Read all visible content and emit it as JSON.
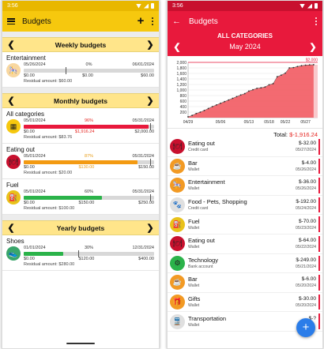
{
  "left": {
    "status_time": "3:56",
    "appbar": {
      "title": "Budgets",
      "add_label": "+"
    },
    "sections": {
      "weekly": {
        "title": "Weekly budgets",
        "items": [
          {
            "name": "Entertainment",
            "start": "05/26/2024",
            "pct": "0%",
            "end": "06/01/2024",
            "spent": "$0.00",
            "mid": "$0.00",
            "budget": "$60.00",
            "residual": "Residual amount: $60.00",
            "fill": 0.0,
            "tick": 0.32,
            "icon": "carousel-icon",
            "color": "#d0d0d0",
            "pct_class": "",
            "mid_class": ""
          }
        ]
      },
      "monthly": {
        "title": "Monthly budgets",
        "items": [
          {
            "name": "All categories",
            "start": "05/01/2024",
            "pct": "96%",
            "end": "05/31/2024",
            "spent": "$0.00",
            "mid": "$1,916.24",
            "budget": "$2,000.00",
            "residual": "Residual amount: $83.76",
            "fill": 0.96,
            "tick": 0.97,
            "icon": "categories-icon",
            "color": "#e8193c",
            "pct_class": "red",
            "mid_class": "red"
          },
          {
            "name": "Eating out",
            "start": "05/01/2024",
            "pct": "87%",
            "end": "05/31/2024",
            "spent": "$0.00",
            "mid": "$130.00",
            "budget": "$150.00",
            "residual": "Residual amount: $20.00",
            "fill": 0.87,
            "tick": 0.97,
            "icon": "dining-icon",
            "color": "#f39a12",
            "pct_class": "orange",
            "mid_class": "orange"
          },
          {
            "name": "Fuel",
            "start": "05/01/2024",
            "pct": "60%",
            "end": "05/31/2024",
            "spent": "$0.00",
            "mid": "$150.00",
            "budget": "$250.00",
            "residual": "Residual amount: $100.00",
            "fill": 0.6,
            "tick": 0.97,
            "icon": "fuel-pump-icon",
            "color": "#2bb34a",
            "pct_class": "",
            "mid_class": ""
          }
        ]
      },
      "yearly": {
        "title": "Yearly budgets",
        "items": [
          {
            "name": "Shoes",
            "start": "01/01/2024",
            "pct": "30%",
            "end": "12/31/2024",
            "spent": "$0.00",
            "mid": "$120.00",
            "budget": "$400.00",
            "residual": "Residual amount: $280.00",
            "fill": 0.3,
            "tick": 0.42,
            "icon": "shoe-icon",
            "color": "#2bb34a",
            "pct_class": "",
            "mid_class": ""
          }
        ]
      }
    }
  },
  "right": {
    "status_time": "3:56",
    "appbar": {
      "title": "Budgets"
    },
    "category_title": "ALL CATEGORIES",
    "month": "May 2024",
    "total_label": "Total:",
    "total_value": "$-1,916.24",
    "transactions": [
      {
        "name": "Eating out",
        "account": "Credit card",
        "amount": "$-32.00",
        "date": "05/27/2024",
        "icon": "dining-icon",
        "icon_bg": "#c8102e"
      },
      {
        "name": "Bar",
        "account": "Wallet",
        "amount": "$-4.00",
        "date": "05/26/2024",
        "icon": "coffee-icon",
        "icon_bg": "#f29a24"
      },
      {
        "name": "Entertainment",
        "account": "Wallet",
        "amount": "$-36.00",
        "date": "05/26/2024",
        "icon": "carousel-icon",
        "icon_bg": "#f29a24"
      },
      {
        "name": "Food - Pets, Shopping",
        "account": "Credit card",
        "amount": "$-192.00",
        "date": "05/24/2024",
        "icon": "pet-food-icon",
        "icon_bg": "#e0e0e0"
      },
      {
        "name": "Fuel",
        "account": "Wallet",
        "amount": "$-70.00",
        "date": "05/23/2024",
        "icon": "fuel-pump-icon",
        "icon_bg": "#e9c21a"
      },
      {
        "name": "Eating out",
        "account": "Wallet",
        "amount": "$-64.00",
        "date": "05/22/2024",
        "icon": "dining-icon",
        "icon_bg": "#c8102e"
      },
      {
        "name": "Technology",
        "account": "Bank account",
        "amount": "$-249.00",
        "date": "05/21/2024",
        "icon": "technology-icon",
        "icon_bg": "#2bb34a"
      },
      {
        "name": "Bar",
        "account": "Wallet",
        "amount": "$-6.00",
        "date": "05/20/2024",
        "icon": "coffee-icon",
        "icon_bg": "#f29a24"
      },
      {
        "name": "Gifts",
        "account": "Wallet",
        "amount": "$-30.00",
        "date": "05/20/2024",
        "icon": "gift-icon",
        "icon_bg": "#f29a24"
      },
      {
        "name": "Transportation",
        "account": "Wallet",
        "amount": "$-?",
        "date": "",
        "icon": "train-icon",
        "icon_bg": "#e0e0e0"
      }
    ]
  },
  "chart_data": {
    "type": "area",
    "title": "",
    "xlabel": "",
    "ylabel": "",
    "ylim": [
      0,
      2000
    ],
    "y_ticks": [
      "200",
      "400",
      "600",
      "800",
      "1,000",
      "1,200",
      "1,400",
      "1,600",
      "1,800",
      "2,000"
    ],
    "x_ticks": [
      "04/29",
      "05/06",
      "05/13",
      "05/18",
      "05/22",
      "05/27"
    ],
    "budget_line": 2000,
    "budget_label": "$2,000",
    "series": [
      {
        "values": [
          {
            "x": "04/29",
            "y": 30
          },
          {
            "x": "04/30",
            "y": 80
          },
          {
            "x": "05/01",
            "y": 150
          },
          {
            "x": "05/02",
            "y": 200
          },
          {
            "x": "05/03",
            "y": 260
          },
          {
            "x": "05/04",
            "y": 330
          },
          {
            "x": "05/05",
            "y": 400
          },
          {
            "x": "05/06",
            "y": 460
          },
          {
            "x": "05/07",
            "y": 520
          },
          {
            "x": "05/08",
            "y": 580
          },
          {
            "x": "05/09",
            "y": 640
          },
          {
            "x": "05/10",
            "y": 700
          },
          {
            "x": "05/11",
            "y": 760
          },
          {
            "x": "05/12",
            "y": 820
          },
          {
            "x": "05/13",
            "y": 870
          },
          {
            "x": "05/14",
            "y": 960
          },
          {
            "x": "05/15",
            "y": 1010
          },
          {
            "x": "05/16",
            "y": 1060
          },
          {
            "x": "05/17",
            "y": 1080
          },
          {
            "x": "05/18",
            "y": 1110
          },
          {
            "x": "05/19",
            "y": 1190
          },
          {
            "x": "05/20",
            "y": 1230
          },
          {
            "x": "05/21",
            "y": 1480
          },
          {
            "x": "05/22",
            "y": 1540
          },
          {
            "x": "05/23",
            "y": 1610
          },
          {
            "x": "05/24",
            "y": 1800
          },
          {
            "x": "05/25",
            "y": 1810
          },
          {
            "x": "05/26",
            "y": 1850
          },
          {
            "x": "05/27",
            "y": 1880
          },
          {
            "x": "05/28",
            "y": 1900
          },
          {
            "x": "05/29",
            "y": 1910
          },
          {
            "x": "05/30",
            "y": 1916
          }
        ]
      }
    ],
    "grid": true,
    "colors": {
      "area": "#f25a62",
      "future": "#f9c9cc",
      "budget": "#e8193c"
    }
  }
}
